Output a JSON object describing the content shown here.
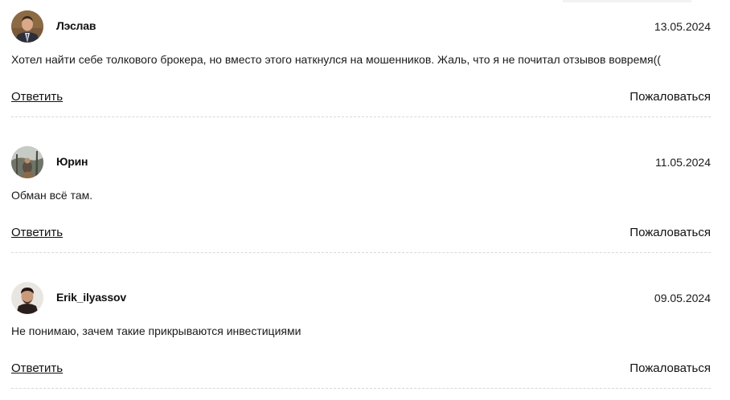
{
  "comments": [
    {
      "author": "Лэслав",
      "date": "13.05.2024",
      "text": "Хотел найти себе толкового брокера, но вместо этого наткнулся на мошенников. Жаль, что я не почитал отзывов вовремя((",
      "reply_label": "Ответить",
      "report_label": "Пожаловаться",
      "avatar": "avatar-man-in-suit"
    },
    {
      "author": "Юрин",
      "date": "11.05.2024",
      "text": "Обман всё там.",
      "reply_label": "Ответить",
      "report_label": "Пожаловаться",
      "avatar": "avatar-outdoor-photo"
    },
    {
      "author": "Erik_ilyassov",
      "date": "09.05.2024",
      "text": "Не понимаю, зачем такие прикрываются инвестициями",
      "reply_label": "Ответить",
      "report_label": "Пожаловаться",
      "avatar": "avatar-young-man"
    }
  ]
}
